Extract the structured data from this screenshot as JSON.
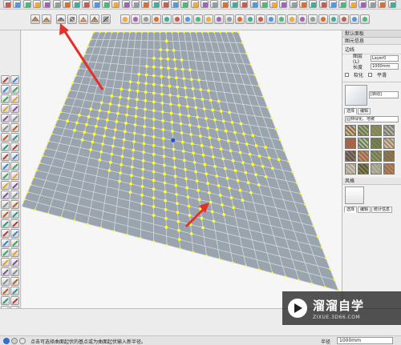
{
  "status_bar": {
    "hint": "点击可选择曲面起伏的基点或为曲面起伏输入新半径。",
    "vcb_label": "半径",
    "vcb_value": "1000mm"
  },
  "right_panel": {
    "title": "默认面板",
    "entity_info": {
      "header": "图元信息",
      "section": "边线",
      "layer_label": "图层(L)",
      "layer_value": "Layer0",
      "length_label": "长度",
      "length_value": "1000mm",
      "soft_label": "软化",
      "smooth_label": "平滑"
    },
    "materials": {
      "thumb_label": "[转动]",
      "tabs": [
        "选择",
        "编辑"
      ],
      "collection": "园林绿化、地被"
    },
    "styles": {
      "header": "风格",
      "tabs": [
        "选择",
        "编辑",
        "统计信息"
      ],
      "label": "有数据"
    }
  },
  "watermark": {
    "title": "溜溜自学",
    "url": "ZIXUE.3D66.COM"
  },
  "colors": {
    "mesh_fill": "#9aa4ae",
    "mesh_line": "#d6dadd",
    "vertex": "#ffff2e",
    "arrow": "#e5302a"
  },
  "icons": {
    "sandbox_toolbar": [
      "sandbox-from-contours-icon",
      "sandbox-from-scratch-icon",
      "smoove-icon",
      "stamp-icon",
      "drape-icon",
      "add-detail-icon",
      "flip-edge-icon"
    ]
  }
}
